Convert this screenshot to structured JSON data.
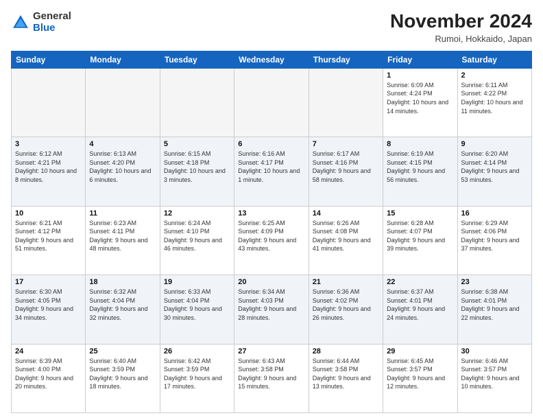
{
  "header": {
    "logo": {
      "general": "General",
      "blue": "Blue"
    },
    "title": "November 2024",
    "location": "Rumoi, Hokkaido, Japan"
  },
  "calendar": {
    "weekdays": [
      "Sunday",
      "Monday",
      "Tuesday",
      "Wednesday",
      "Thursday",
      "Friday",
      "Saturday"
    ],
    "weeks": [
      [
        {
          "day": "",
          "info": ""
        },
        {
          "day": "",
          "info": ""
        },
        {
          "day": "",
          "info": ""
        },
        {
          "day": "",
          "info": ""
        },
        {
          "day": "",
          "info": ""
        },
        {
          "day": "1",
          "info": "Sunrise: 6:09 AM\nSunset: 4:24 PM\nDaylight: 10 hours and 14 minutes."
        },
        {
          "day": "2",
          "info": "Sunrise: 6:11 AM\nSunset: 4:22 PM\nDaylight: 10 hours and 11 minutes."
        }
      ],
      [
        {
          "day": "3",
          "info": "Sunrise: 6:12 AM\nSunset: 4:21 PM\nDaylight: 10 hours and 8 minutes."
        },
        {
          "day": "4",
          "info": "Sunrise: 6:13 AM\nSunset: 4:20 PM\nDaylight: 10 hours and 6 minutes."
        },
        {
          "day": "5",
          "info": "Sunrise: 6:15 AM\nSunset: 4:18 PM\nDaylight: 10 hours and 3 minutes."
        },
        {
          "day": "6",
          "info": "Sunrise: 6:16 AM\nSunset: 4:17 PM\nDaylight: 10 hours and 1 minute."
        },
        {
          "day": "7",
          "info": "Sunrise: 6:17 AM\nSunset: 4:16 PM\nDaylight: 9 hours and 58 minutes."
        },
        {
          "day": "8",
          "info": "Sunrise: 6:19 AM\nSunset: 4:15 PM\nDaylight: 9 hours and 56 minutes."
        },
        {
          "day": "9",
          "info": "Sunrise: 6:20 AM\nSunset: 4:14 PM\nDaylight: 9 hours and 53 minutes."
        }
      ],
      [
        {
          "day": "10",
          "info": "Sunrise: 6:21 AM\nSunset: 4:12 PM\nDaylight: 9 hours and 51 minutes."
        },
        {
          "day": "11",
          "info": "Sunrise: 6:23 AM\nSunset: 4:11 PM\nDaylight: 9 hours and 48 minutes."
        },
        {
          "day": "12",
          "info": "Sunrise: 6:24 AM\nSunset: 4:10 PM\nDaylight: 9 hours and 46 minutes."
        },
        {
          "day": "13",
          "info": "Sunrise: 6:25 AM\nSunset: 4:09 PM\nDaylight: 9 hours and 43 minutes."
        },
        {
          "day": "14",
          "info": "Sunrise: 6:26 AM\nSunset: 4:08 PM\nDaylight: 9 hours and 41 minutes."
        },
        {
          "day": "15",
          "info": "Sunrise: 6:28 AM\nSunset: 4:07 PM\nDaylight: 9 hours and 39 minutes."
        },
        {
          "day": "16",
          "info": "Sunrise: 6:29 AM\nSunset: 4:06 PM\nDaylight: 9 hours and 37 minutes."
        }
      ],
      [
        {
          "day": "17",
          "info": "Sunrise: 6:30 AM\nSunset: 4:05 PM\nDaylight: 9 hours and 34 minutes."
        },
        {
          "day": "18",
          "info": "Sunrise: 6:32 AM\nSunset: 4:04 PM\nDaylight: 9 hours and 32 minutes."
        },
        {
          "day": "19",
          "info": "Sunrise: 6:33 AM\nSunset: 4:04 PM\nDaylight: 9 hours and 30 minutes."
        },
        {
          "day": "20",
          "info": "Sunrise: 6:34 AM\nSunset: 4:03 PM\nDaylight: 9 hours and 28 minutes."
        },
        {
          "day": "21",
          "info": "Sunrise: 6:36 AM\nSunset: 4:02 PM\nDaylight: 9 hours and 26 minutes."
        },
        {
          "day": "22",
          "info": "Sunrise: 6:37 AM\nSunset: 4:01 PM\nDaylight: 9 hours and 24 minutes."
        },
        {
          "day": "23",
          "info": "Sunrise: 6:38 AM\nSunset: 4:01 PM\nDaylight: 9 hours and 22 minutes."
        }
      ],
      [
        {
          "day": "24",
          "info": "Sunrise: 6:39 AM\nSunset: 4:00 PM\nDaylight: 9 hours and 20 minutes."
        },
        {
          "day": "25",
          "info": "Sunrise: 6:40 AM\nSunset: 3:59 PM\nDaylight: 9 hours and 18 minutes."
        },
        {
          "day": "26",
          "info": "Sunrise: 6:42 AM\nSunset: 3:59 PM\nDaylight: 9 hours and 17 minutes."
        },
        {
          "day": "27",
          "info": "Sunrise: 6:43 AM\nSunset: 3:58 PM\nDaylight: 9 hours and 15 minutes."
        },
        {
          "day": "28",
          "info": "Sunrise: 6:44 AM\nSunset: 3:58 PM\nDaylight: 9 hours and 13 minutes."
        },
        {
          "day": "29",
          "info": "Sunrise: 6:45 AM\nSunset: 3:57 PM\nDaylight: 9 hours and 12 minutes."
        },
        {
          "day": "30",
          "info": "Sunrise: 6:46 AM\nSunset: 3:57 PM\nDaylight: 9 hours and 10 minutes."
        }
      ]
    ]
  }
}
